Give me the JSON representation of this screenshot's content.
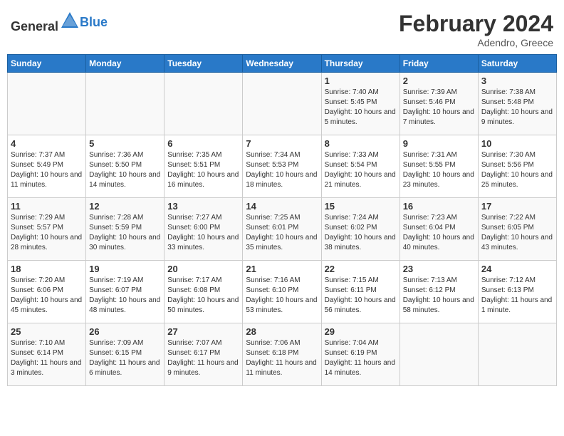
{
  "header": {
    "logo_general": "General",
    "logo_blue": "Blue",
    "month_year": "February 2024",
    "location": "Adendro, Greece"
  },
  "weekdays": [
    "Sunday",
    "Monday",
    "Tuesday",
    "Wednesday",
    "Thursday",
    "Friday",
    "Saturday"
  ],
  "weeks": [
    [
      {
        "day": "",
        "sunrise": "",
        "sunset": "",
        "daylight": ""
      },
      {
        "day": "",
        "sunrise": "",
        "sunset": "",
        "daylight": ""
      },
      {
        "day": "",
        "sunrise": "",
        "sunset": "",
        "daylight": ""
      },
      {
        "day": "",
        "sunrise": "",
        "sunset": "",
        "daylight": ""
      },
      {
        "day": "1",
        "sunrise": "Sunrise: 7:40 AM",
        "sunset": "Sunset: 5:45 PM",
        "daylight": "Daylight: 10 hours and 5 minutes."
      },
      {
        "day": "2",
        "sunrise": "Sunrise: 7:39 AM",
        "sunset": "Sunset: 5:46 PM",
        "daylight": "Daylight: 10 hours and 7 minutes."
      },
      {
        "day": "3",
        "sunrise": "Sunrise: 7:38 AM",
        "sunset": "Sunset: 5:48 PM",
        "daylight": "Daylight: 10 hours and 9 minutes."
      }
    ],
    [
      {
        "day": "4",
        "sunrise": "Sunrise: 7:37 AM",
        "sunset": "Sunset: 5:49 PM",
        "daylight": "Daylight: 10 hours and 11 minutes."
      },
      {
        "day": "5",
        "sunrise": "Sunrise: 7:36 AM",
        "sunset": "Sunset: 5:50 PM",
        "daylight": "Daylight: 10 hours and 14 minutes."
      },
      {
        "day": "6",
        "sunrise": "Sunrise: 7:35 AM",
        "sunset": "Sunset: 5:51 PM",
        "daylight": "Daylight: 10 hours and 16 minutes."
      },
      {
        "day": "7",
        "sunrise": "Sunrise: 7:34 AM",
        "sunset": "Sunset: 5:53 PM",
        "daylight": "Daylight: 10 hours and 18 minutes."
      },
      {
        "day": "8",
        "sunrise": "Sunrise: 7:33 AM",
        "sunset": "Sunset: 5:54 PM",
        "daylight": "Daylight: 10 hours and 21 minutes."
      },
      {
        "day": "9",
        "sunrise": "Sunrise: 7:31 AM",
        "sunset": "Sunset: 5:55 PM",
        "daylight": "Daylight: 10 hours and 23 minutes."
      },
      {
        "day": "10",
        "sunrise": "Sunrise: 7:30 AM",
        "sunset": "Sunset: 5:56 PM",
        "daylight": "Daylight: 10 hours and 25 minutes."
      }
    ],
    [
      {
        "day": "11",
        "sunrise": "Sunrise: 7:29 AM",
        "sunset": "Sunset: 5:57 PM",
        "daylight": "Daylight: 10 hours and 28 minutes."
      },
      {
        "day": "12",
        "sunrise": "Sunrise: 7:28 AM",
        "sunset": "Sunset: 5:59 PM",
        "daylight": "Daylight: 10 hours and 30 minutes."
      },
      {
        "day": "13",
        "sunrise": "Sunrise: 7:27 AM",
        "sunset": "Sunset: 6:00 PM",
        "daylight": "Daylight: 10 hours and 33 minutes."
      },
      {
        "day": "14",
        "sunrise": "Sunrise: 7:25 AM",
        "sunset": "Sunset: 6:01 PM",
        "daylight": "Daylight: 10 hours and 35 minutes."
      },
      {
        "day": "15",
        "sunrise": "Sunrise: 7:24 AM",
        "sunset": "Sunset: 6:02 PM",
        "daylight": "Daylight: 10 hours and 38 minutes."
      },
      {
        "day": "16",
        "sunrise": "Sunrise: 7:23 AM",
        "sunset": "Sunset: 6:04 PM",
        "daylight": "Daylight: 10 hours and 40 minutes."
      },
      {
        "day": "17",
        "sunrise": "Sunrise: 7:22 AM",
        "sunset": "Sunset: 6:05 PM",
        "daylight": "Daylight: 10 hours and 43 minutes."
      }
    ],
    [
      {
        "day": "18",
        "sunrise": "Sunrise: 7:20 AM",
        "sunset": "Sunset: 6:06 PM",
        "daylight": "Daylight: 10 hours and 45 minutes."
      },
      {
        "day": "19",
        "sunrise": "Sunrise: 7:19 AM",
        "sunset": "Sunset: 6:07 PM",
        "daylight": "Daylight: 10 hours and 48 minutes."
      },
      {
        "day": "20",
        "sunrise": "Sunrise: 7:17 AM",
        "sunset": "Sunset: 6:08 PM",
        "daylight": "Daylight: 10 hours and 50 minutes."
      },
      {
        "day": "21",
        "sunrise": "Sunrise: 7:16 AM",
        "sunset": "Sunset: 6:10 PM",
        "daylight": "Daylight: 10 hours and 53 minutes."
      },
      {
        "day": "22",
        "sunrise": "Sunrise: 7:15 AM",
        "sunset": "Sunset: 6:11 PM",
        "daylight": "Daylight: 10 hours and 56 minutes."
      },
      {
        "day": "23",
        "sunrise": "Sunrise: 7:13 AM",
        "sunset": "Sunset: 6:12 PM",
        "daylight": "Daylight: 10 hours and 58 minutes."
      },
      {
        "day": "24",
        "sunrise": "Sunrise: 7:12 AM",
        "sunset": "Sunset: 6:13 PM",
        "daylight": "Daylight: 11 hours and 1 minute."
      }
    ],
    [
      {
        "day": "25",
        "sunrise": "Sunrise: 7:10 AM",
        "sunset": "Sunset: 6:14 PM",
        "daylight": "Daylight: 11 hours and 3 minutes."
      },
      {
        "day": "26",
        "sunrise": "Sunrise: 7:09 AM",
        "sunset": "Sunset: 6:15 PM",
        "daylight": "Daylight: 11 hours and 6 minutes."
      },
      {
        "day": "27",
        "sunrise": "Sunrise: 7:07 AM",
        "sunset": "Sunset: 6:17 PM",
        "daylight": "Daylight: 11 hours and 9 minutes."
      },
      {
        "day": "28",
        "sunrise": "Sunrise: 7:06 AM",
        "sunset": "Sunset: 6:18 PM",
        "daylight": "Daylight: 11 hours and 11 minutes."
      },
      {
        "day": "29",
        "sunrise": "Sunrise: 7:04 AM",
        "sunset": "Sunset: 6:19 PM",
        "daylight": "Daylight: 11 hours and 14 minutes."
      },
      {
        "day": "",
        "sunrise": "",
        "sunset": "",
        "daylight": ""
      },
      {
        "day": "",
        "sunrise": "",
        "sunset": "",
        "daylight": ""
      }
    ]
  ]
}
